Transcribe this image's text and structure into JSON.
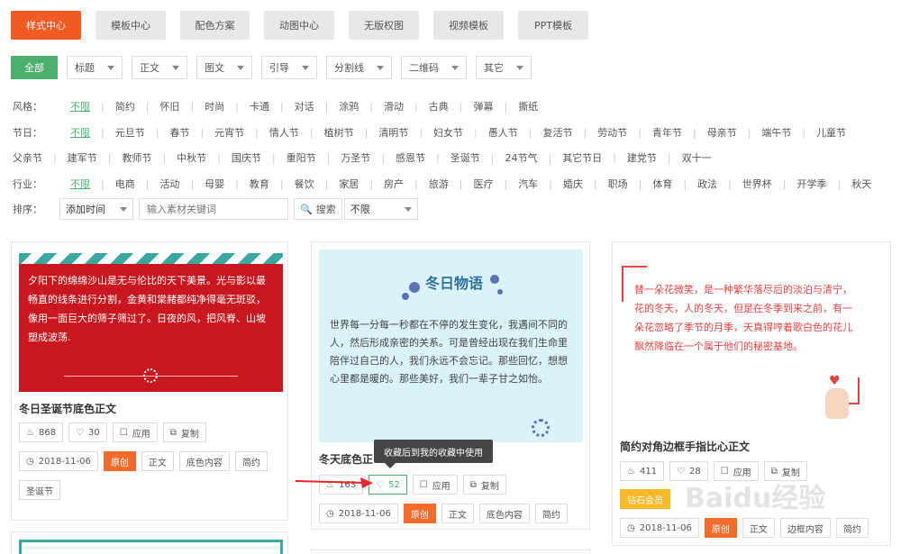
{
  "top_tabs": [
    "样式中心",
    "模板中心",
    "配色方案",
    "动图中心",
    "无版权图",
    "视频模板",
    "PPT模板"
  ],
  "filters": {
    "all": "全部",
    "items": [
      "标题",
      "正文",
      "图文",
      "引导",
      "分割线",
      "二维码",
      "其它"
    ]
  },
  "rows": {
    "style": {
      "label": "风格：",
      "tags": [
        "不限",
        "简约",
        "怀旧",
        "时尚",
        "卡通",
        "对话",
        "涂鸦",
        "滑动",
        "古典",
        "弹幕",
        "撕纸"
      ]
    },
    "holiday": {
      "label": "节日：",
      "tags": [
        "不限",
        "元旦节",
        "春节",
        "元宵节",
        "情人节",
        "植树节",
        "清明节",
        "妇女节",
        "愚人节",
        "复活节",
        "劳动节",
        "青年节",
        "母亲节",
        "端午节",
        "儿童节"
      ],
      "tags2": [
        "父亲节",
        "建军节",
        "教师节",
        "中秋节",
        "国庆节",
        "重阳节",
        "万圣节",
        "感恩节",
        "圣诞节",
        "24节气",
        "其它节日",
        "建党节",
        "双十一"
      ]
    },
    "industry": {
      "label": "行业：",
      "tags": [
        "不限",
        "电商",
        "活动",
        "母婴",
        "教育",
        "餐饮",
        "家居",
        "房产",
        "旅游",
        "医疗",
        "汽车",
        "婚庆",
        "职场",
        "体育",
        "政法",
        "世界杯",
        "开学季",
        "秋天"
      ]
    }
  },
  "sort": {
    "label": "排序：",
    "order": "添加时间",
    "search_placeholder": "输入素材关键词",
    "search_btn": "搜索",
    "limit": "不限"
  },
  "cards": [
    {
      "title": "冬日圣诞节底色正文",
      "preview_text": "夕阳下的绵绵沙山是无与伦比的天下美景。光与影以最畅直的线条进行分割，金黄和棠赭都纯净得毫无斑驳，像用一面巨大的筛子筛过了。日夜的风，把风脊、山坡塑成波荡.",
      "views": "868",
      "likes": "30",
      "apply": "应用",
      "copy": "复制",
      "date": "2018-11-06",
      "tags": [
        "原创",
        "正文",
        "底色内容",
        "简约",
        "圣诞节"
      ]
    },
    {
      "title": "冬天底色正",
      "preview_title": "冬日物语",
      "preview_text": "世界每一分每一秒都在不停的发生变化，我遇间不同的人，然后形成亲密的关系。可是曾经出现在我们生命里陪伴过自己的人，我们永远不会忘记。那些回忆，想想心里都是暖的。那些美好，我们一辈子甘之如怡。",
      "views": "163",
      "likes": "52",
      "apply": "应用",
      "copy": "复制",
      "date": "2018-11-06",
      "tags": [
        "原创",
        "正文",
        "底色内容",
        "简约"
      ]
    },
    {
      "title": "简约对角边框手指比心正文",
      "preview_text": "替一朵花微笑，是一种繁华落尽后的淡泊与清宁，花的冬天，人的冬天，但是在冬季到来之前，有一朵花忽略了季节的月季，天真得哼着歌白色的花儿飘然降临在一个属于他们的秘密基地。",
      "views": "411",
      "likes": "28",
      "apply": "应用",
      "copy": "复制",
      "vip": "钻石会员",
      "date": "2018-11-06",
      "tags": [
        "原创",
        "正文",
        "边框内容",
        "简约"
      ]
    }
  ],
  "tooltip": "收藏后到我的收藏中使用",
  "watermark": "Baidu经验",
  "colors": {
    "accent": "#f05b24",
    "green": "#4caf6e",
    "red": "#c8171e"
  }
}
